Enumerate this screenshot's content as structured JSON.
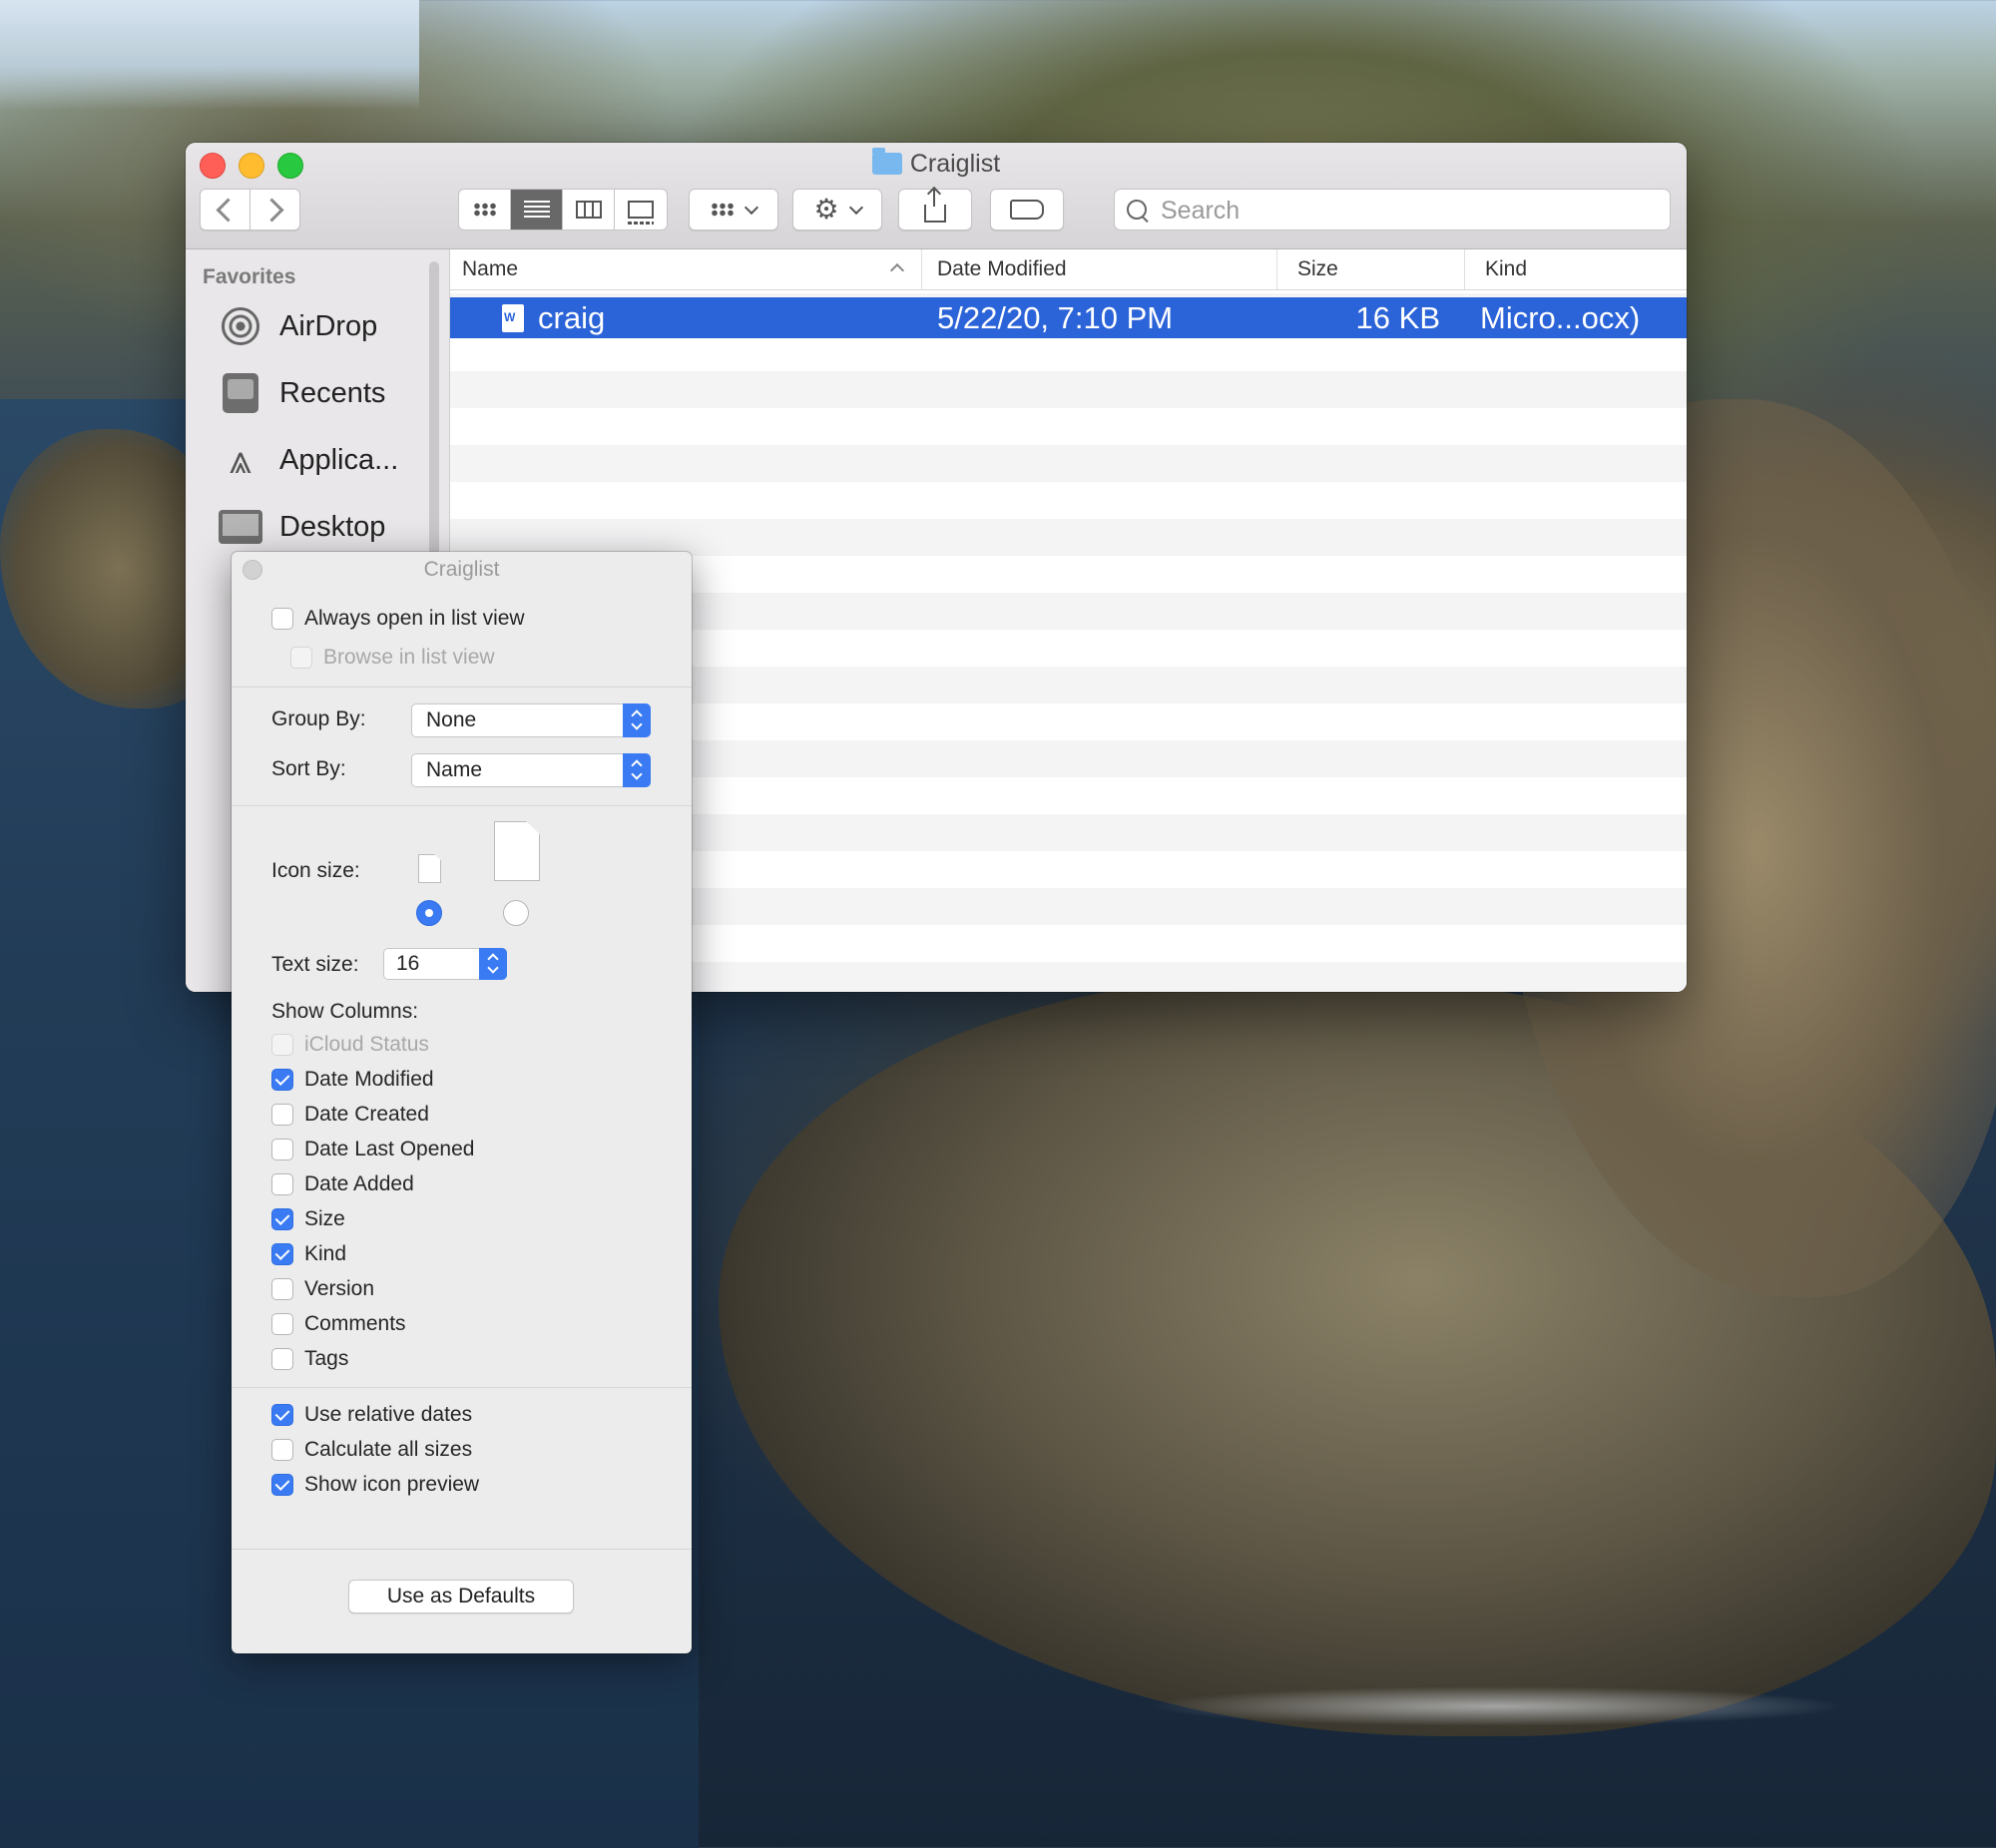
{
  "window": {
    "title": "Craiglist",
    "search_placeholder": "Search"
  },
  "sidebar": {
    "header": "Favorites",
    "items": [
      {
        "label": "AirDrop",
        "icon": "airdrop-icon"
      },
      {
        "label": "Recents",
        "icon": "recents-icon"
      },
      {
        "label": "Applica...",
        "icon": "applications-icon"
      },
      {
        "label": "Desktop",
        "icon": "desktop-icon"
      }
    ]
  },
  "list": {
    "columns": [
      "Name",
      "Date Modified",
      "Size",
      "Kind"
    ],
    "rows": [
      {
        "name": "craig",
        "date": "5/22/20, 7:10 PM",
        "size": "16 KB",
        "kind": "Micro...ocx)",
        "selected": true
      }
    ]
  },
  "panel": {
    "title": "Craiglist",
    "always_open": {
      "label": "Always open in list view",
      "checked": false
    },
    "browse": {
      "label": "Browse in list view",
      "checked": false,
      "disabled": true
    },
    "group_by": {
      "label": "Group By:",
      "value": "None"
    },
    "sort_by": {
      "label": "Sort By:",
      "value": "Name"
    },
    "icon_size_label": "Icon size:",
    "icon_size_selected": "small",
    "text_size": {
      "label": "Text size:",
      "value": "16"
    },
    "show_columns_label": "Show Columns:",
    "columns": [
      {
        "label": "iCloud Status",
        "checked": false,
        "disabled": true
      },
      {
        "label": "Date Modified",
        "checked": true
      },
      {
        "label": "Date Created",
        "checked": false
      },
      {
        "label": "Date Last Opened",
        "checked": false
      },
      {
        "label": "Date Added",
        "checked": false
      },
      {
        "label": "Size",
        "checked": true
      },
      {
        "label": "Kind",
        "checked": true
      },
      {
        "label": "Version",
        "checked": false
      },
      {
        "label": "Comments",
        "checked": false
      },
      {
        "label": "Tags",
        "checked": false
      }
    ],
    "options": [
      {
        "label": "Use relative dates",
        "checked": true
      },
      {
        "label": "Calculate all sizes",
        "checked": false
      },
      {
        "label": "Show icon preview",
        "checked": true
      }
    ],
    "defaults_button": "Use as Defaults"
  },
  "colors": {
    "selection": "#2b63d8",
    "accent": "#3a7bf4"
  }
}
